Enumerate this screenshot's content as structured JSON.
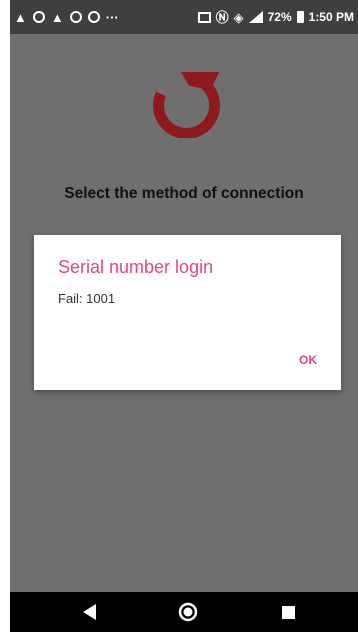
{
  "status_bar": {
    "notification_icons": [
      "warning-icon",
      "sync-icon",
      "warning-icon",
      "sync-icon",
      "sync-icon"
    ],
    "overflow": "···",
    "battery_percent": "72%",
    "time": "1:50 PM"
  },
  "app": {
    "logo_color": "#8e1a1c",
    "headline": "Select the method of connection"
  },
  "dialog": {
    "title": "Serial number login",
    "message": "Fail: 1001",
    "ok_label": "OK",
    "accent_color": "#e8467a"
  },
  "nav_bar": {
    "buttons": [
      "back-icon",
      "home-icon",
      "recents-icon"
    ]
  }
}
